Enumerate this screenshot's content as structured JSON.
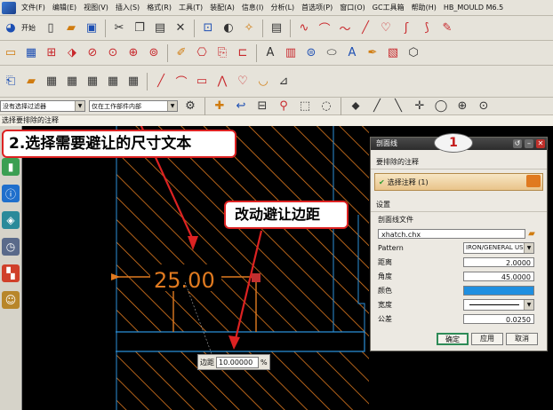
{
  "menubar": {
    "items": [
      "文件(F)",
      "编辑(E)",
      "视图(V)",
      "插入(S)",
      "格式(R)",
      "工具(T)",
      "装配(A)",
      "信息(I)",
      "分析(L)",
      "首选项(P)",
      "窗口(O)",
      "GC工具箱",
      "帮助(H)",
      "HB_MOULD M6.5"
    ]
  },
  "toolbar": {
    "start_label": "开始"
  },
  "selection_bar": {
    "filter_value": "没有选择过滤器",
    "scope_value": "仅在工作部件内部"
  },
  "cue_line": "选择要排除的注释",
  "annotations": {
    "step2": "2.选择需要避让的尺寸文本",
    "offset_callout": "改动避让边距",
    "badge": "1",
    "dimension_text": "25.00"
  },
  "offset_box": {
    "label": "边距",
    "value": "10.00000",
    "unit": "%"
  },
  "dialog": {
    "title": "剖面线",
    "section_exclude": "要排除的注释",
    "select_note_label": "选择注释 (1)",
    "section_settings": "设置",
    "hatch_file_label": "剖面线文件",
    "hatch_file_value": "xhatch.chx",
    "pattern_label": "Pattern",
    "pattern_value": "IRON/GENERAL US",
    "distance_label": "距离",
    "distance_value": "2.0000",
    "angle_label": "角度",
    "angle_value": "45.0000",
    "color_label": "颜色",
    "color_value": "#1f8fe0",
    "width_label": "宽度",
    "tolerance_label": "公差",
    "tolerance_value": "0.0250",
    "ok_label": "确定",
    "apply_label": "应用",
    "cancel_label": "取消"
  },
  "colors": {
    "hatch": "#e07a20",
    "outline": "#2b8fd8",
    "callout_border": "#dd2222"
  }
}
